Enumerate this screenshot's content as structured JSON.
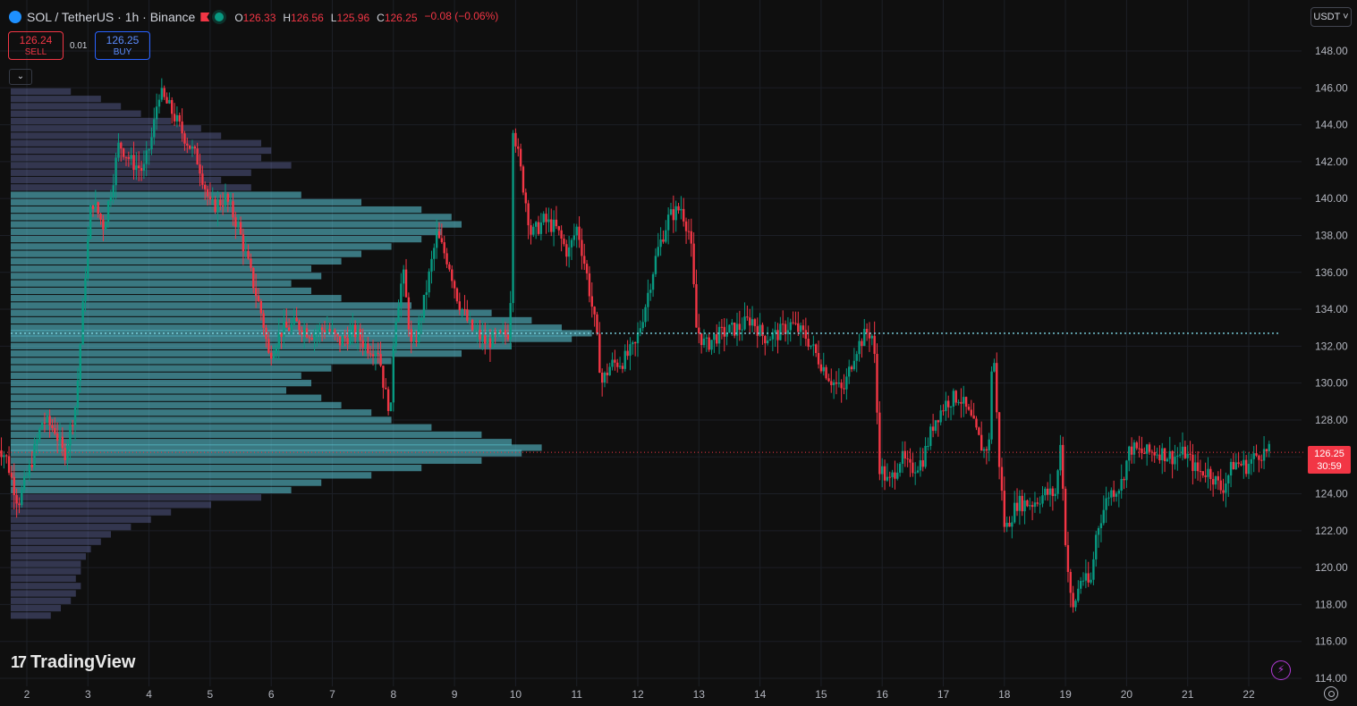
{
  "header": {
    "symbol": "SOL / TetherUS · 1h · Binance",
    "o_label": "O",
    "o_value": "126.33",
    "h_label": "H",
    "h_value": "126.56",
    "l_label": "L",
    "l_value": "125.96",
    "c_label": "C",
    "c_value": "126.25",
    "change": "−0.08 (−0.06%)"
  },
  "trade": {
    "sell_price": "126.24",
    "sell_label": "SELL",
    "spread": "0.01",
    "buy_price": "126.25",
    "buy_label": "BUY"
  },
  "currency_button": "USDT",
  "collapse_icon": "chevron-down-icon",
  "price_tag": {
    "price": "126.25",
    "countdown": "30:59"
  },
  "brand": {
    "name": "TradingView"
  },
  "colors": {
    "background": "#0f0f0f",
    "up": "#089981",
    "down": "#f23645",
    "grid": "#1c1f26",
    "profile": "#5fd0e0",
    "poc_line": "#7dd8e6"
  },
  "chart_data": {
    "type": "candlestick",
    "title": "SOL / TetherUS · 1h · Binance",
    "ylim": [
      114,
      149
    ],
    "xlim": [
      1.5,
      22.7
    ],
    "y_ticks": [
      "114.00",
      "116.00",
      "118.00",
      "120.00",
      "122.00",
      "124.00",
      "126.00",
      "128.00",
      "130.00",
      "132.00",
      "134.00",
      "136.00",
      "138.00",
      "140.00",
      "142.00",
      "144.00",
      "146.00",
      "148.00"
    ],
    "x_ticks": [
      "2",
      "3",
      "4",
      "5",
      "6",
      "7",
      "8",
      "9",
      "10",
      "11",
      "12",
      "13",
      "14",
      "15",
      "16",
      "17",
      "18",
      "19",
      "20",
      "21",
      "22"
    ],
    "last_price": 126.25,
    "poc_price": 132.7,
    "path_points": [
      [
        1.5,
        127.0
      ],
      [
        1.7,
        126.0
      ],
      [
        1.9,
        123.5
      ],
      [
        2.1,
        125.5
      ],
      [
        2.3,
        128.0
      ],
      [
        2.5,
        127.5
      ],
      [
        2.65,
        126.0
      ],
      [
        2.85,
        129.0
      ],
      [
        3.0,
        136.0
      ],
      [
        3.1,
        140.0
      ],
      [
        3.3,
        138.5
      ],
      [
        3.45,
        141.0
      ],
      [
        3.55,
        143.0
      ],
      [
        3.75,
        142.0
      ],
      [
        3.95,
        141.5
      ],
      [
        4.1,
        143.5
      ],
      [
        4.2,
        145.8
      ],
      [
        4.4,
        144.8
      ],
      [
        4.6,
        143.5
      ],
      [
        4.85,
        142.0
      ],
      [
        5.05,
        139.5
      ],
      [
        5.3,
        140.0
      ],
      [
        5.5,
        138.5
      ],
      [
        5.7,
        136.0
      ],
      [
        5.9,
        133.5
      ],
      [
        6.0,
        131.5
      ],
      [
        6.2,
        132.8
      ],
      [
        6.45,
        133.2
      ],
      [
        6.7,
        132.7
      ],
      [
        6.95,
        133.0
      ],
      [
        7.15,
        132.2
      ],
      [
        7.4,
        132.8
      ],
      [
        7.6,
        132.0
      ],
      [
        7.8,
        131.8
      ],
      [
        7.9,
        129.5
      ],
      [
        8.0,
        128.5
      ],
      [
        8.05,
        133.0
      ],
      [
        8.2,
        136.0
      ],
      [
        8.35,
        131.5
      ],
      [
        8.55,
        134.5
      ],
      [
        8.75,
        138.0
      ],
      [
        8.95,
        136.5
      ],
      [
        9.1,
        134.5
      ],
      [
        9.3,
        133.0
      ],
      [
        9.55,
        132.2
      ],
      [
        9.8,
        132.5
      ],
      [
        9.95,
        132.8
      ],
      [
        10.0,
        144.0
      ],
      [
        10.15,
        141.0
      ],
      [
        10.3,
        138.0
      ],
      [
        10.5,
        138.8
      ],
      [
        10.7,
        138.4
      ],
      [
        10.9,
        137.0
      ],
      [
        11.05,
        138.5
      ],
      [
        11.2,
        136.0
      ],
      [
        11.35,
        133.0
      ],
      [
        11.45,
        130.0
      ],
      [
        11.6,
        131.0
      ],
      [
        11.8,
        131.2
      ],
      [
        12.0,
        132.0
      ],
      [
        12.15,
        134.0
      ],
      [
        12.35,
        137.0
      ],
      [
        12.55,
        139.0
      ],
      [
        12.75,
        139.5
      ],
      [
        12.9,
        138.0
      ],
      [
        13.0,
        133.0
      ],
      [
        13.15,
        132.0
      ],
      [
        13.3,
        132.5
      ],
      [
        13.5,
        132.8
      ],
      [
        13.7,
        133.0
      ],
      [
        13.9,
        133.5
      ],
      [
        14.1,
        132.5
      ],
      [
        14.3,
        132.6
      ],
      [
        14.55,
        133.2
      ],
      [
        14.8,
        132.5
      ],
      [
        15.0,
        131.3
      ],
      [
        15.2,
        130.2
      ],
      [
        15.4,
        129.5
      ],
      [
        15.6,
        131.8
      ],
      [
        15.8,
        132.8
      ],
      [
        15.9,
        132.5
      ],
      [
        16.0,
        125.5
      ],
      [
        16.15,
        124.5
      ],
      [
        16.35,
        126.0
      ],
      [
        16.5,
        125.3
      ],
      [
        16.7,
        125.8
      ],
      [
        16.9,
        128.0
      ],
      [
        17.1,
        129.0
      ],
      [
        17.3,
        129.3
      ],
      [
        17.5,
        128.0
      ],
      [
        17.7,
        126.3
      ],
      [
        17.8,
        126.8
      ],
      [
        17.85,
        132.8
      ],
      [
        17.95,
        126.0
      ],
      [
        18.05,
        122.0
      ],
      [
        18.25,
        123.5
      ],
      [
        18.5,
        123.5
      ],
      [
        18.7,
        124.0
      ],
      [
        18.9,
        124.0
      ],
      [
        18.95,
        127.5
      ],
      [
        19.05,
        121.0
      ],
      [
        19.15,
        117.5
      ],
      [
        19.3,
        119.5
      ],
      [
        19.45,
        119.0
      ],
      [
        19.55,
        122.0
      ],
      [
        19.75,
        124.0
      ],
      [
        19.95,
        124.5
      ],
      [
        20.1,
        126.5
      ],
      [
        20.3,
        126.2
      ],
      [
        20.55,
        126.3
      ],
      [
        20.8,
        126.0
      ],
      [
        21.0,
        126.2
      ],
      [
        21.2,
        125.2
      ],
      [
        21.4,
        125.2
      ],
      [
        21.6,
        124.2
      ],
      [
        21.8,
        125.7
      ],
      [
        22.0,
        125.5
      ],
      [
        22.2,
        126.2
      ],
      [
        22.35,
        126.25
      ]
    ],
    "volume_profile": [
      [
        145.8,
        0.12
      ],
      [
        145.4,
        0.18
      ],
      [
        145.0,
        0.22
      ],
      [
        144.6,
        0.26
      ],
      [
        144.2,
        0.32
      ],
      [
        143.8,
        0.38
      ],
      [
        143.4,
        0.42
      ],
      [
        143.0,
        0.5
      ],
      [
        142.6,
        0.52
      ],
      [
        142.2,
        0.5
      ],
      [
        141.8,
        0.56
      ],
      [
        141.4,
        0.48
      ],
      [
        141.0,
        0.42
      ],
      [
        140.6,
        0.48
      ],
      [
        140.2,
        0.58
      ],
      [
        139.8,
        0.7
      ],
      [
        139.4,
        0.82
      ],
      [
        139.0,
        0.88
      ],
      [
        138.6,
        0.9
      ],
      [
        138.2,
        0.86
      ],
      [
        137.8,
        0.82
      ],
      [
        137.4,
        0.76
      ],
      [
        137.0,
        0.7
      ],
      [
        136.6,
        0.66
      ],
      [
        136.2,
        0.6
      ],
      [
        135.8,
        0.62
      ],
      [
        135.4,
        0.56
      ],
      [
        135.0,
        0.6
      ],
      [
        134.6,
        0.66
      ],
      [
        134.2,
        0.8
      ],
      [
        133.8,
        0.96
      ],
      [
        133.4,
        1.04
      ],
      [
        133.0,
        1.1
      ],
      [
        132.7,
        1.16
      ],
      [
        132.4,
        1.12
      ],
      [
        132.0,
        1.0
      ],
      [
        131.6,
        0.9
      ],
      [
        131.2,
        0.76
      ],
      [
        130.8,
        0.64
      ],
      [
        130.4,
        0.58
      ],
      [
        130.0,
        0.6
      ],
      [
        129.6,
        0.55
      ],
      [
        129.2,
        0.62
      ],
      [
        128.8,
        0.66
      ],
      [
        128.4,
        0.72
      ],
      [
        128.0,
        0.76
      ],
      [
        127.6,
        0.84
      ],
      [
        127.2,
        0.94
      ],
      [
        126.8,
        1.0
      ],
      [
        126.5,
        1.06
      ],
      [
        126.2,
        1.02
      ],
      [
        125.8,
        0.94
      ],
      [
        125.4,
        0.82
      ],
      [
        125.0,
        0.72
      ],
      [
        124.6,
        0.62
      ],
      [
        124.2,
        0.56
      ],
      [
        123.8,
        0.5
      ],
      [
        123.4,
        0.4
      ],
      [
        123.0,
        0.32
      ],
      [
        122.6,
        0.28
      ],
      [
        122.2,
        0.24
      ],
      [
        121.8,
        0.2
      ],
      [
        121.4,
        0.18
      ],
      [
        121.0,
        0.16
      ],
      [
        120.6,
        0.15
      ],
      [
        120.2,
        0.14
      ],
      [
        119.8,
        0.14
      ],
      [
        119.4,
        0.13
      ],
      [
        119.0,
        0.14
      ],
      [
        118.6,
        0.13
      ],
      [
        118.2,
        0.12
      ],
      [
        117.8,
        0.1
      ],
      [
        117.4,
        0.08
      ]
    ]
  }
}
